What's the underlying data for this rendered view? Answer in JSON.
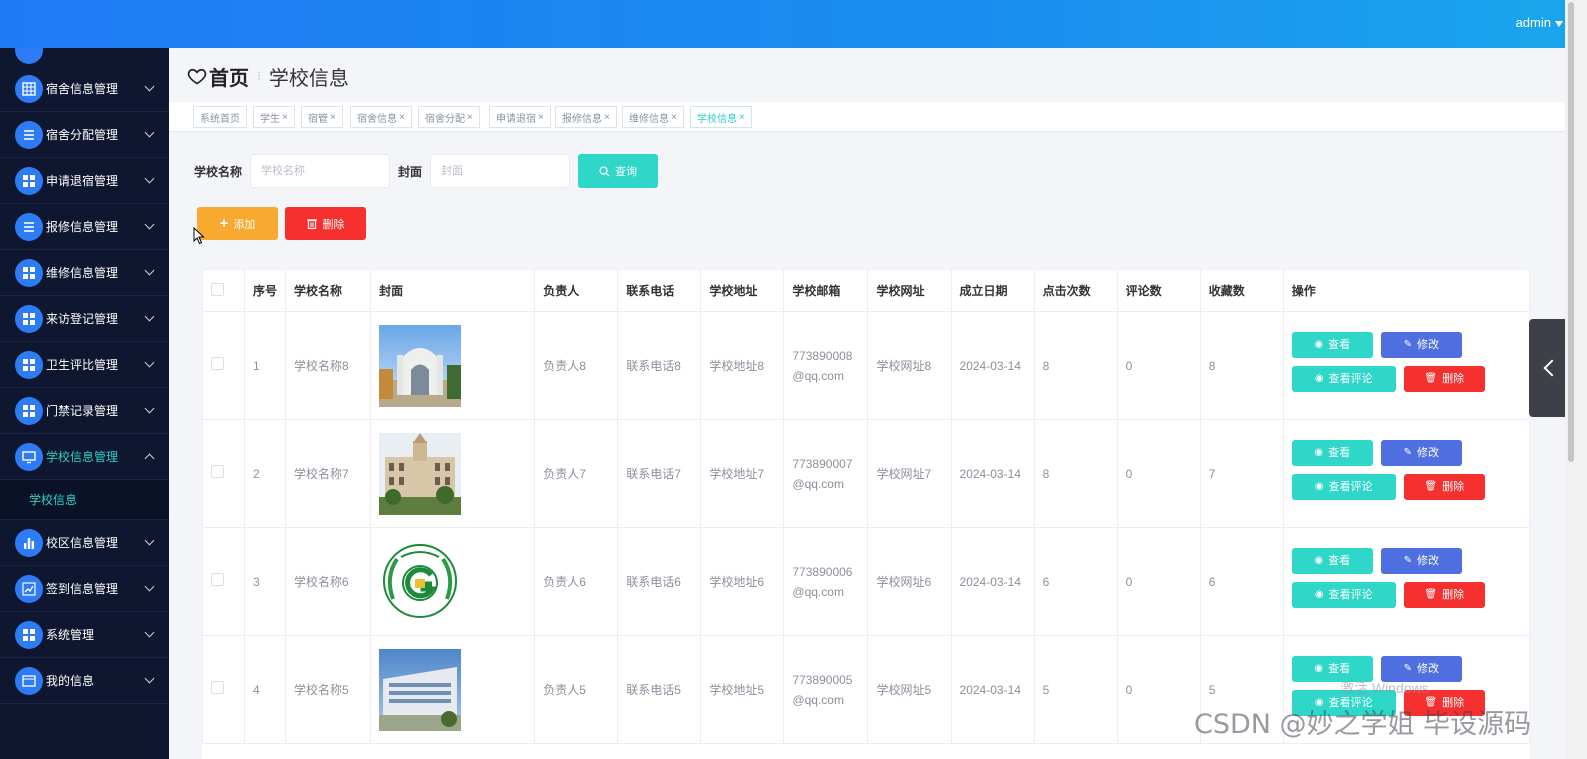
{
  "topbar": {
    "user": "admin"
  },
  "sidebar": {
    "items": [
      {
        "label": "宿舍信息管理",
        "icon": "grid-icon"
      },
      {
        "label": "宿舍分配管理",
        "icon": "list-icon"
      },
      {
        "label": "申请退宿管理",
        "icon": "apps-icon"
      },
      {
        "label": "报修信息管理",
        "icon": "list-icon"
      },
      {
        "label": "维修信息管理",
        "icon": "apps-icon"
      },
      {
        "label": "来访登记管理",
        "icon": "apps-icon"
      },
      {
        "label": "卫生评比管理",
        "icon": "apps-icon"
      },
      {
        "label": "门禁记录管理",
        "icon": "apps-icon"
      },
      {
        "label": "学校信息管理",
        "icon": "monitor-icon",
        "expanded": true
      },
      {
        "label": "校区信息管理",
        "icon": "bar-chart-icon"
      },
      {
        "label": "签到信息管理",
        "icon": "trend-icon"
      },
      {
        "label": "系统管理",
        "icon": "apps-icon"
      },
      {
        "label": "我的信息",
        "icon": "id-card-icon"
      }
    ],
    "sub_item": "学校信息"
  },
  "breadcrumb": {
    "home": "首页",
    "current": "学校信息"
  },
  "tabs": [
    {
      "label": "系统首页",
      "closable": false
    },
    {
      "label": "学生",
      "closable": true
    },
    {
      "label": "宿管",
      "closable": true
    },
    {
      "label": "宿舍信息",
      "closable": true
    },
    {
      "label": "宿舍分配",
      "closable": true
    },
    {
      "label": "申请退宿",
      "closable": true
    },
    {
      "label": "报修信息",
      "closable": true
    },
    {
      "label": "维修信息",
      "closable": true
    },
    {
      "label": "学校信息",
      "closable": true,
      "active": true
    }
  ],
  "tab_close_glyph": "×",
  "search": {
    "name_label": "学校名称",
    "name_placeholder": "学校名称",
    "cover_label": "封面",
    "cover_placeholder": "封面",
    "query_button": "查询"
  },
  "actions": {
    "add": "添加",
    "delete": "删除"
  },
  "table": {
    "columns": [
      "序号",
      "学校名称",
      "封面",
      "负责人",
      "联系电话",
      "学校地址",
      "学校邮箱",
      "学校网址",
      "成立日期",
      "点击次数",
      "评论数",
      "收藏数",
      "操作"
    ],
    "rows": [
      {
        "no": "1",
        "name": "学校名称8",
        "cover": "gate-photo",
        "owner": "负责人8",
        "phone": "联系电话8",
        "address": "学校地址8",
        "email": "773890008@qq.com",
        "site": "学校网址8",
        "date": "2024-03-14",
        "clicks": "8",
        "comments": "0",
        "favorites": "8"
      },
      {
        "no": "2",
        "name": "学校名称7",
        "cover": "building-photo",
        "owner": "负责人7",
        "phone": "联系电话7",
        "address": "学校地址7",
        "email": "773890007@qq.com",
        "site": "学校网址7",
        "date": "2024-03-14",
        "clicks": "8",
        "comments": "0",
        "favorites": "7"
      },
      {
        "no": "3",
        "name": "学校名称6",
        "cover": "university-emblem",
        "owner": "负责人6",
        "phone": "联系电话6",
        "address": "学校地址6",
        "email": "773890006@qq.com",
        "site": "学校网址6",
        "date": "2024-03-14",
        "clicks": "6",
        "comments": "0",
        "favorites": "6"
      },
      {
        "no": "4",
        "name": "学校名称5",
        "cover": "campus-photo",
        "owner": "负责人5",
        "phone": "联系电话5",
        "address": "学校地址5",
        "email": "773890005@qq.com",
        "site": "学校网址5",
        "date": "2024-03-14",
        "clicks": "5",
        "comments": "0",
        "favorites": "5"
      }
    ],
    "ops": {
      "view": "查看",
      "edit": "修改",
      "comments": "查看评论",
      "delete": "删除"
    }
  },
  "overlay": {
    "windows_text": "激活 Windows",
    "watermark": "CSDN @妙之学姐 毕设源码"
  },
  "colors": {
    "topbar": "#1e7bf5",
    "sidebar": "#0f1730",
    "accent": "#2fd7c9",
    "danger": "#f5302e",
    "warning": "#f7a930",
    "edit": "#4f6fe0"
  }
}
